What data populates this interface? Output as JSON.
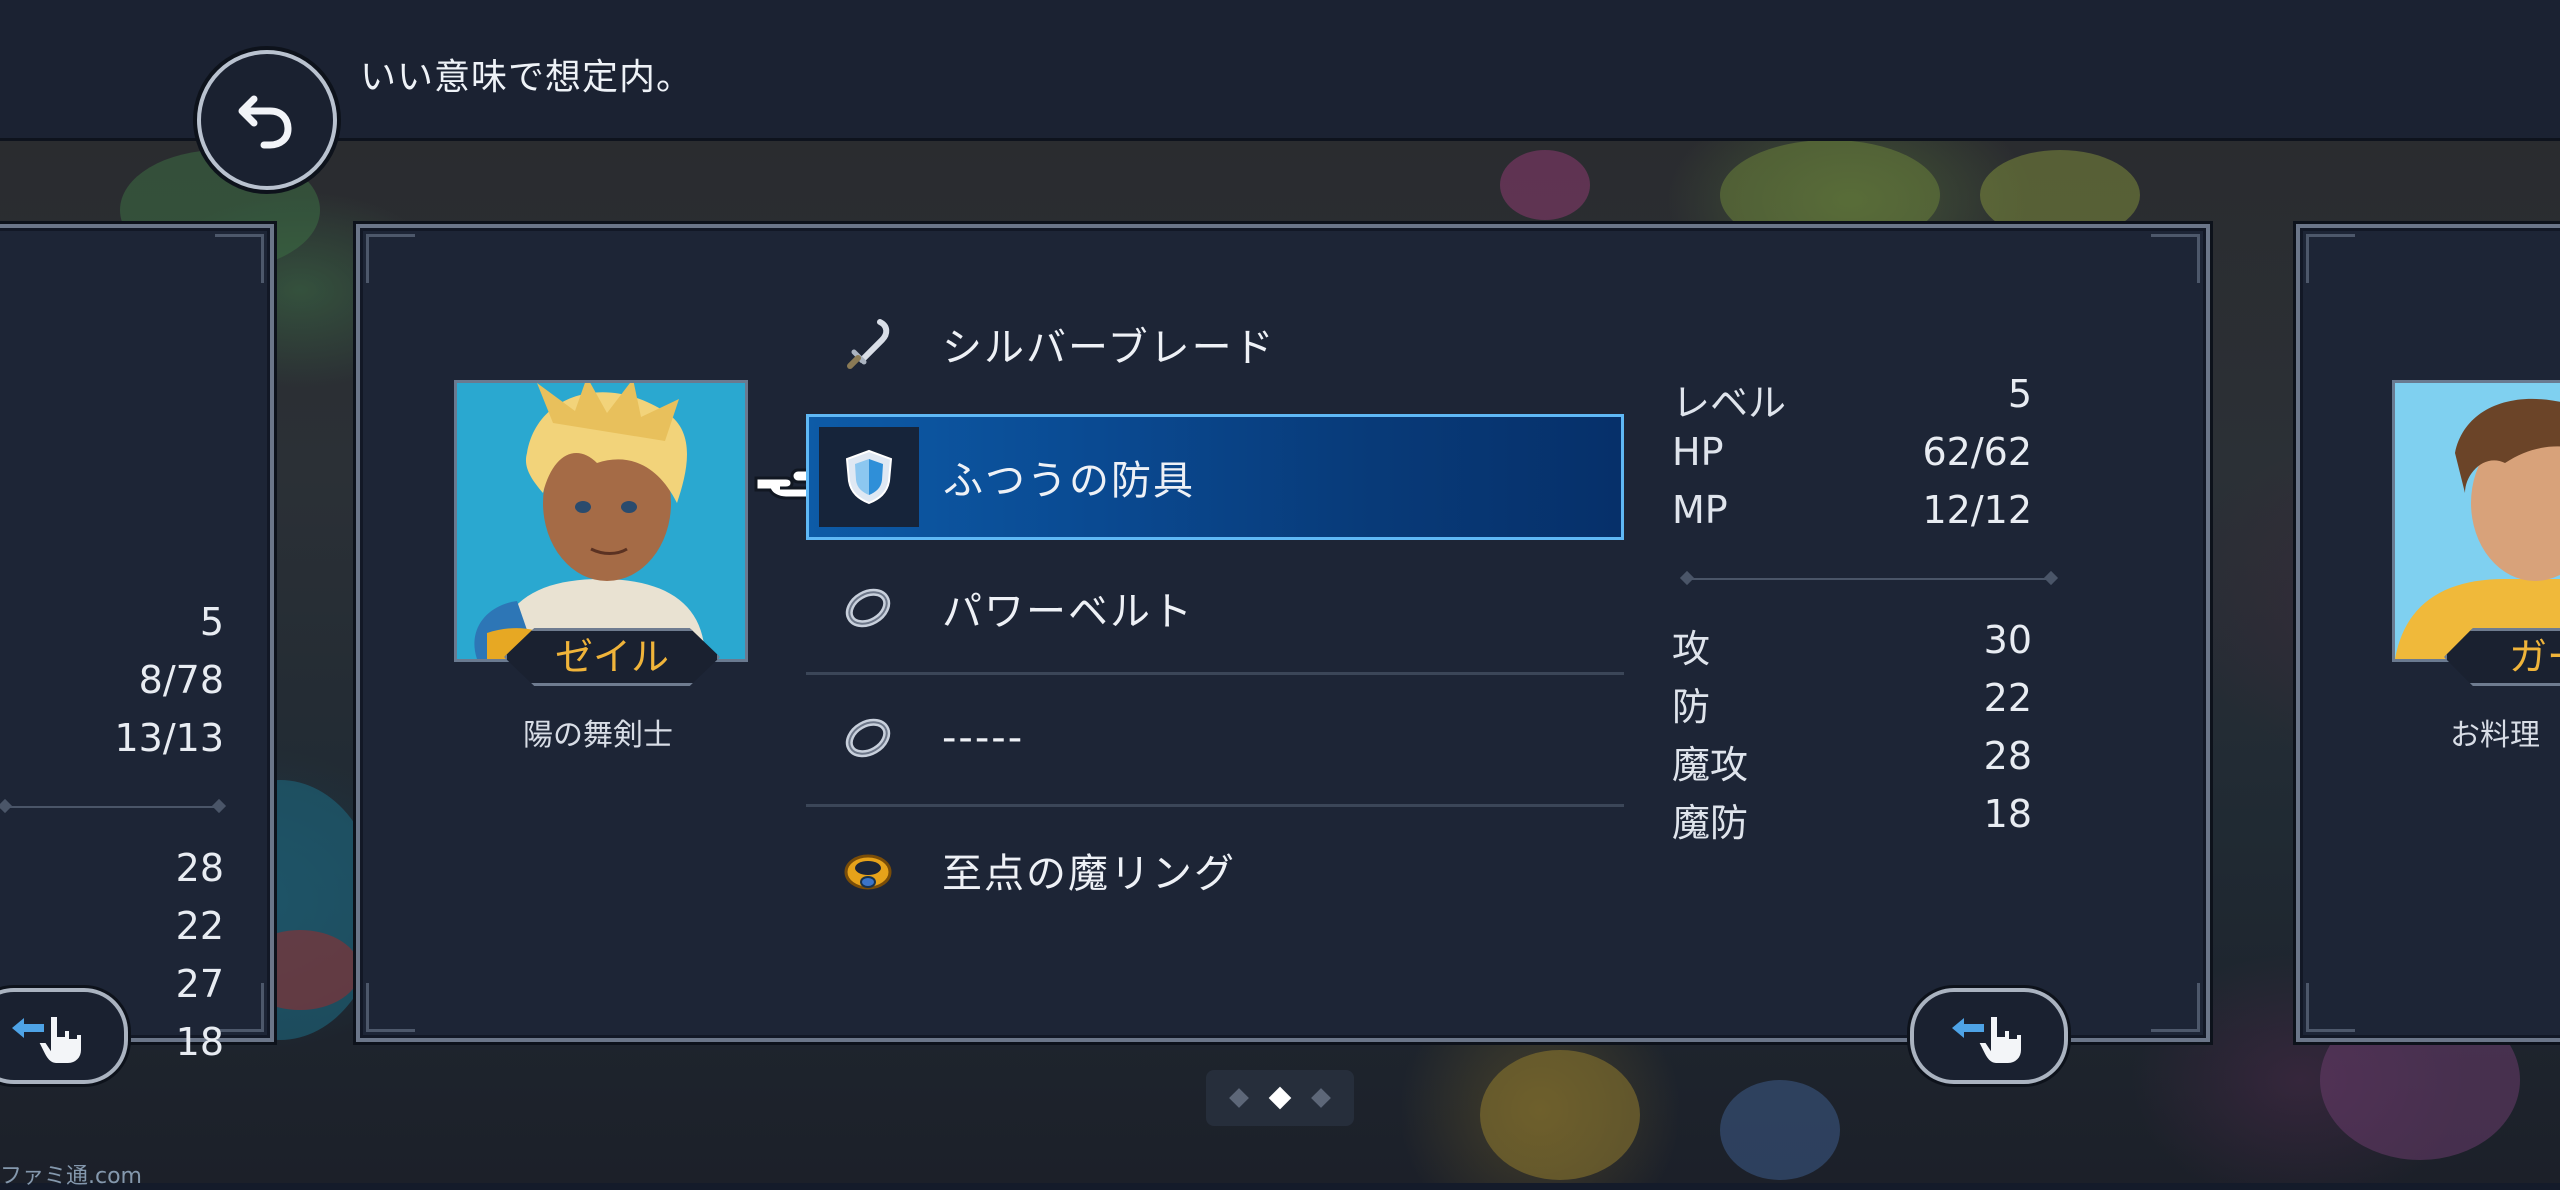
{
  "topbar": {
    "message": "いい意味で想定内。"
  },
  "main_character": {
    "name": "ゼイル",
    "title": "陽の舞剣士",
    "equipment": [
      {
        "icon": "sword-icon",
        "label": "シルバーブレード",
        "selected": false
      },
      {
        "icon": "shield-icon",
        "label": "ふつうの防具",
        "selected": true
      },
      {
        "icon": "ring-icon",
        "label": "パワーベルト",
        "selected": false
      },
      {
        "icon": "ring-icon",
        "label": "-----",
        "selected": false
      },
      {
        "icon": "amulet-icon",
        "label": "至点の魔リング",
        "selected": false
      }
    ],
    "stats_top": [
      {
        "label": "レベル",
        "value": "5"
      },
      {
        "label": "HP",
        "value": "62/62"
      },
      {
        "label": "MP",
        "value": "12/12"
      }
    ],
    "stats_bottom": [
      {
        "label": "攻",
        "value": "30"
      },
      {
        "label": "防",
        "value": "22"
      },
      {
        "label": "魔攻",
        "value": "28"
      },
      {
        "label": "魔防",
        "value": "18"
      }
    ]
  },
  "left_character": {
    "stats_top": [
      "5",
      "8/78",
      "13/13"
    ],
    "stats_bottom": [
      "28",
      "22",
      "27",
      "18"
    ]
  },
  "right_character": {
    "name_partial": "ガー",
    "title_partial": "お料理"
  },
  "pagination": {
    "total": 3,
    "active": 2
  },
  "watermark": "ファミ通.com",
  "colors": {
    "accent_name": "#f0b43a",
    "selection": "#0d5ba7",
    "selection_border": "#5fb8f5",
    "panel": "#1d2536"
  }
}
